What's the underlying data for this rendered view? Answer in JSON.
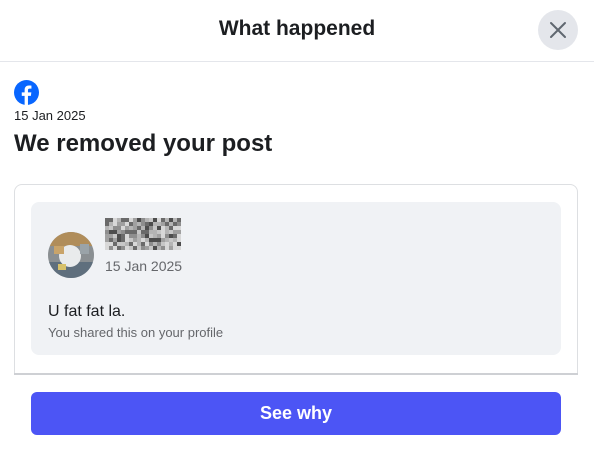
{
  "header": {
    "title": "What happened",
    "close_icon": "close-icon"
  },
  "notice": {
    "app_icon": "facebook-logo-icon",
    "date": "15 Jan 2025",
    "headline": "We removed your post"
  },
  "post": {
    "author_name_obscured": true,
    "date": "15 Jan 2025",
    "text": "U fat fat la.",
    "visibility_note": "You shared this on your profile"
  },
  "actions": {
    "see_why_label": "See why"
  },
  "colors": {
    "primary_button": "#4c55f5",
    "facebook_blue": "#0866ff",
    "card_background": "#f0f2f5",
    "secondary_text": "#65676b"
  }
}
